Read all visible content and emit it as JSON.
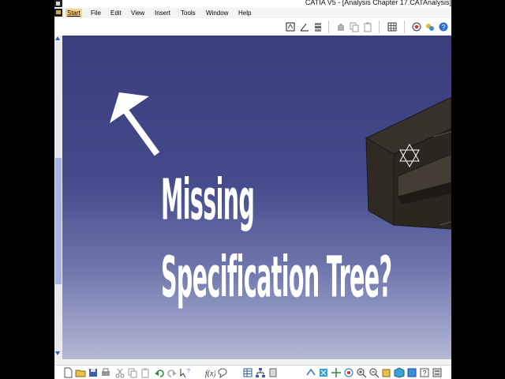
{
  "window": {
    "title": "CATIA V5 - [Analysis Chapter 17.CATAnalysis]"
  },
  "menu": {
    "items": [
      {
        "label": "Start",
        "active": true
      },
      {
        "label": "File"
      },
      {
        "label": "Edit"
      },
      {
        "label": "View"
      },
      {
        "label": "Insert"
      },
      {
        "label": "Tools"
      },
      {
        "label": "Window"
      },
      {
        "label": "Help"
      }
    ]
  },
  "overlay": {
    "line1": "Missing",
    "line2": "Specification Tree?"
  },
  "colors": {
    "viewport_top": "#3a3d7c",
    "viewport_bottom": "#b4b8d6",
    "part_fill": "#2d2a23",
    "accent_blue": "#3a5fc4"
  },
  "top_toolbar_icons": [
    "sketch-icon",
    "angle-icon",
    "stack-icon",
    "hand-icon",
    "copy-icon",
    "paste-icon",
    "grid-icon",
    "compass-icon",
    "render-icon",
    "help-icon"
  ],
  "bottom_toolbar_icons": [
    "new-icon",
    "open-icon",
    "save-icon",
    "print-icon",
    "cut-icon",
    "copy-icon",
    "paste-icon",
    "undo-icon",
    "redo-icon",
    "whats-this-icon",
    "formula-icon",
    "comment-icon",
    "table-icon",
    "tree-icon",
    "catalog-icon",
    "fly-icon",
    "fit-all-icon",
    "pan-icon",
    "rotate-icon",
    "zoom-in-icon",
    "zoom-out-icon",
    "normal-view-icon",
    "iso-view-icon",
    "shading-icon",
    "hide-show-icon",
    "swap-icon"
  ]
}
